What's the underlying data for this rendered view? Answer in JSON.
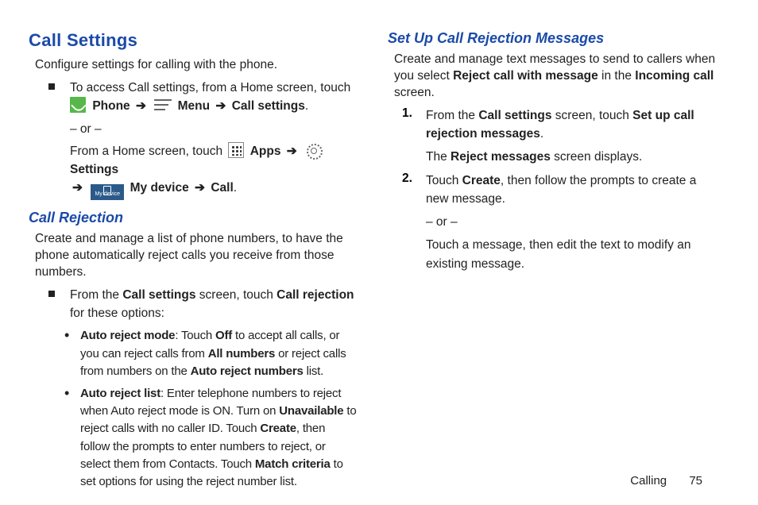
{
  "left": {
    "title": "Call Settings",
    "intro": "Configure settings for calling with the phone.",
    "access": {
      "line1_pre": "To access Call settings, from a Home screen, touch ",
      "phone_label": " Phone ",
      "menu_label": " Menu ",
      "call_settings": " Call settings",
      "or": "– or –",
      "line2_pre": "From a Home screen, touch ",
      "apps_label": " Apps ",
      "settings_label": " Settings",
      "mydevice_label": " My device ",
      "mydevice_icon_text": "My device",
      "call_label": " Call"
    },
    "rejection": {
      "heading": "Call Rejection",
      "intro": "Create and manage a list of phone numbers, to have the phone automatically reject calls you receive from those numbers.",
      "step_pre": "From the ",
      "step_b1": "Call settings",
      "step_mid": " screen, touch ",
      "step_b2": "Call rejection",
      "step_post": " for these options:",
      "opt1_title": "Auto reject mode",
      "opt1_body_a": ": Touch ",
      "opt1_off": "Off",
      "opt1_body_b": " to accept all calls, or you can reject calls from ",
      "opt1_all": "All numbers",
      "opt1_body_c": " or reject calls from numbers on the ",
      "opt1_list": "Auto reject numbers",
      "opt1_body_d": " list.",
      "opt2_title": "Auto reject list",
      "opt2_body_a": ": Enter telephone numbers to reject when Auto reject mode is ON. Turn on ",
      "opt2_unavail": "Unavailable",
      "opt2_body_b": " to reject calls with no caller ID. Touch ",
      "opt2_create": "Create",
      "opt2_body_c": ", then follow the prompts to enter numbers to reject, or select them from Contacts. Touch ",
      "opt2_match": "Match criteria",
      "opt2_body_d": " to set options for using the reject number list."
    }
  },
  "right": {
    "heading": "Set Up Call Rejection Messages",
    "intro_a": "Create and manage text messages to send to callers when you select ",
    "intro_b1": "Reject call with message",
    "intro_b": " in the ",
    "intro_b2": "Incoming call",
    "intro_c": " screen.",
    "step1": {
      "num": "1.",
      "a": "From the ",
      "b1": "Call settings",
      "b": " screen, touch ",
      "b2": "Set up call rejection messages",
      "c": ".",
      "note_a": "The ",
      "note_b": "Reject messages",
      "note_c": " screen displays."
    },
    "step2": {
      "num": "2.",
      "a": "Touch ",
      "b1": "Create",
      "b": ", then follow the prompts to create a new message.",
      "or": "– or –",
      "alt": "Touch a message, then edit the text to modify an existing message."
    }
  },
  "footer": {
    "section": "Calling",
    "page": "75"
  },
  "glyphs": {
    "arrow": "➔"
  }
}
